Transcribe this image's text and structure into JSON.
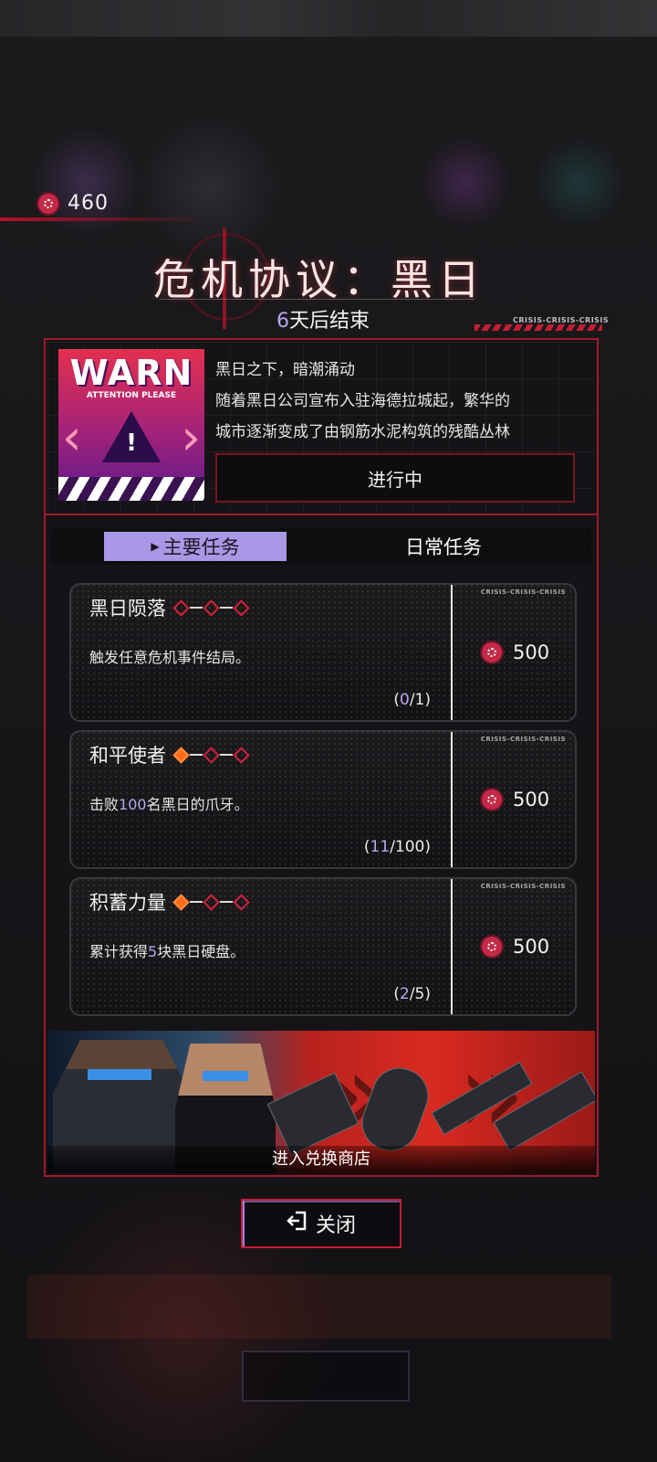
{
  "currency": {
    "icon": "crisis-coin-icon",
    "value": "460"
  },
  "event": {
    "title": "危机协议：黑日",
    "ends_in_number": "6",
    "ends_in_suffix": "天后结束",
    "crisis_tag": "CRISIS-CRISIS-CRISIS",
    "poster": {
      "title": "WARN",
      "subtitle": "ATTENTION PLEASE"
    },
    "description_lines": [
      "黑日之下，暗潮涌动",
      "随着黑日公司宣布入驻海德拉城起，繁华的",
      "城市逐渐变成了由钢筋水泥构筑的残酷丛林"
    ],
    "status": "进行中"
  },
  "tabs": [
    {
      "label": "主要任务",
      "active": true
    },
    {
      "label": "日常任务",
      "active": false
    }
  ],
  "quests": [
    {
      "title": "黑日陨落",
      "stars_earned": 0,
      "stars_total": 3,
      "desc_pre": "触发任意危机事件结局。",
      "desc_hl": "",
      "desc_post": "",
      "progress_current": "0",
      "progress_total": "/1)",
      "progress_open": "(",
      "reward": "500",
      "tag": "CRISIS-CRISIS-CRISIS"
    },
    {
      "title": "和平使者",
      "stars_earned": 1,
      "stars_total": 3,
      "desc_pre": "击败",
      "desc_hl": "100",
      "desc_post": "名黑日的爪牙。",
      "progress_current": "11",
      "progress_total": "/100)",
      "progress_open": "(",
      "reward": "500",
      "tag": "CRISIS-CRISIS-CRISIS"
    },
    {
      "title": "积蓄力量",
      "stars_earned": 1,
      "stars_total": 3,
      "desc_pre": "累计获得",
      "desc_hl": "5",
      "desc_post": "块黑日硬盘。",
      "progress_current": "2",
      "progress_total": "/5)",
      "progress_open": "(",
      "reward": "500",
      "tag": "CRISIS-CRISIS-CRISIS"
    }
  ],
  "shop": {
    "label": "进入兑换商店"
  },
  "close": {
    "label": "关闭",
    "icon": "exit-icon"
  },
  "colors": {
    "accent_red": "#a0192c",
    "accent_purple": "#a998e6",
    "highlight": "#b8a6f0",
    "star_on": "#ff6a1a"
  }
}
